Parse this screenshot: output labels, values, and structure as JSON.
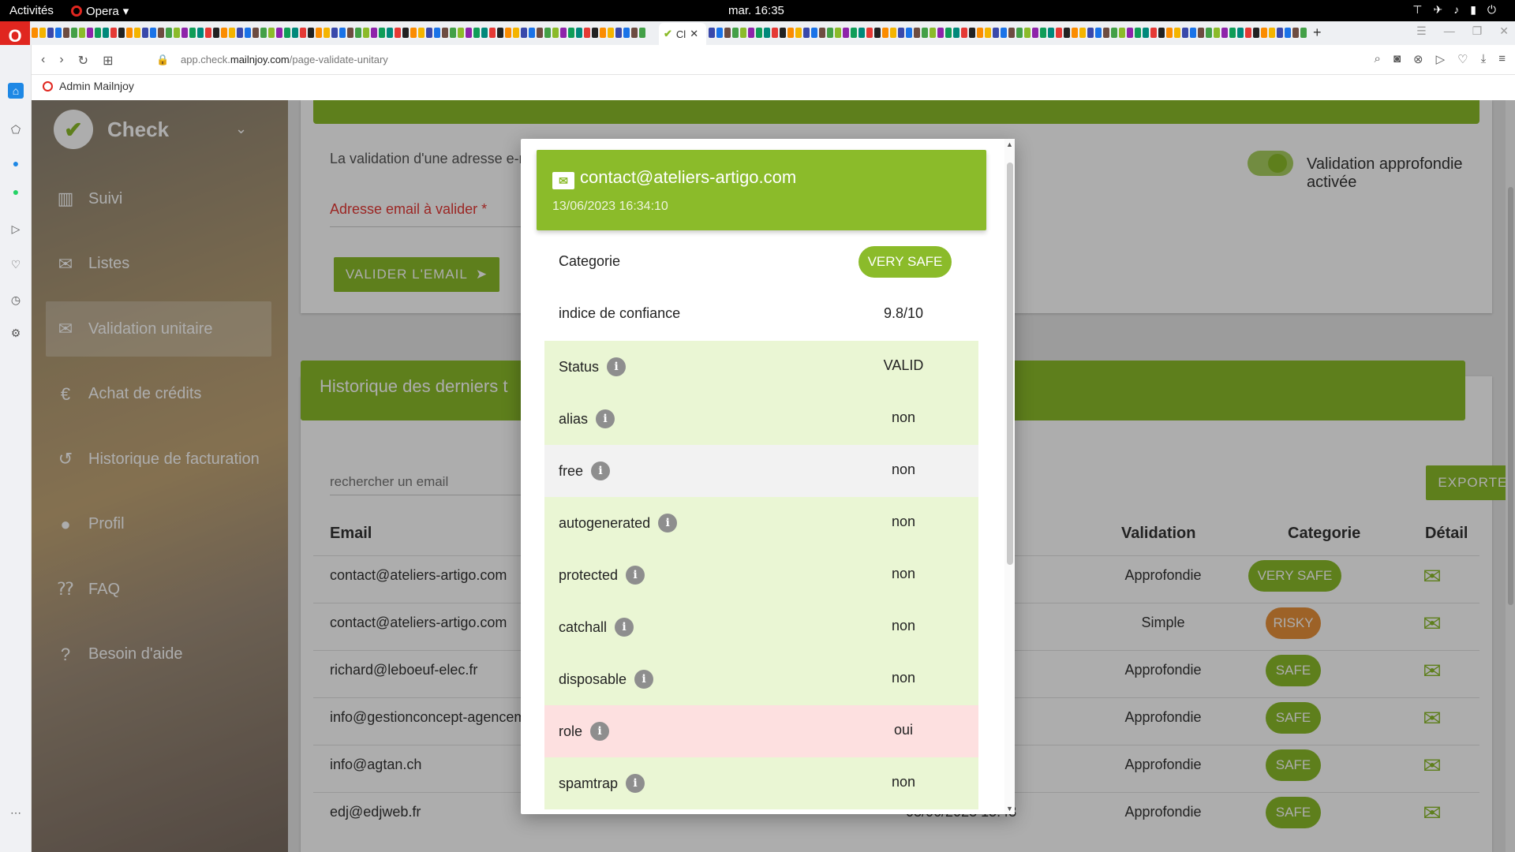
{
  "system_bar": {
    "activities": "Activités",
    "app_name": "Opera",
    "clock": "mar. 16:35"
  },
  "browser": {
    "active_tab_label": "Cl",
    "url_prefix": "app.check.",
    "url_domain": "mailnjoy.com",
    "url_path": "/page-validate-unitary",
    "bookmark": "Admin Mailnjoy"
  },
  "sidebar": {
    "brand": "Check",
    "items": [
      {
        "label": "Suivi",
        "icon": "bar-chart-icon"
      },
      {
        "label": "Listes",
        "icon": "mail-icon"
      },
      {
        "label": "Validation unitaire",
        "icon": "mail-icon"
      },
      {
        "label": "Achat de crédits",
        "icon": "euro-icon"
      },
      {
        "label": "Historique de facturation",
        "icon": "history-icon"
      },
      {
        "label": "Profil",
        "icon": "person-icon"
      },
      {
        "label": "FAQ",
        "icon": "faq-icon"
      },
      {
        "label": "Besoin d'aide",
        "icon": "help-icon"
      }
    ],
    "active_index": 2
  },
  "validate": {
    "intro": "La validation d'une adresse e-mai",
    "email_label": "Adresse email à valider *",
    "button": "VALIDER L'EMAIL",
    "toggle_label": "Validation approfondie activée"
  },
  "history": {
    "title": "Historique des derniers t",
    "search_placeholder": "rechercher un email",
    "export_button": "EXPORTER",
    "headers": {
      "email": "Email",
      "validation": "Validation",
      "categorie": "Categorie",
      "detail": "Détail"
    },
    "rows": [
      {
        "email": "contact@ateliers-artigo.com",
        "date": "",
        "validation": "Approfondie",
        "categorie": "VERY SAFE",
        "cat_class": "very-safe"
      },
      {
        "email": "contact@ateliers-artigo.com",
        "date": "",
        "validation": "Simple",
        "categorie": "RISKY",
        "cat_class": "risky"
      },
      {
        "email": "richard@leboeuf-elec.fr",
        "date": "",
        "validation": "Approfondie",
        "categorie": "SAFE",
        "cat_class": "safe"
      },
      {
        "email": "info@gestionconcept-agencem",
        "date": "",
        "validation": "Approfondie",
        "categorie": "SAFE",
        "cat_class": "safe"
      },
      {
        "email": "info@agtan.ch",
        "date": "",
        "validation": "Approfondie",
        "categorie": "SAFE",
        "cat_class": "safe"
      },
      {
        "email": "edj@edjweb.fr",
        "date": "03/06/2023 15:43",
        "validation": "Approfondie",
        "categorie": "SAFE",
        "cat_class": "safe"
      }
    ]
  },
  "modal": {
    "email": "contact@ateliers-artigo.com",
    "date": "13/06/2023 16:34:10",
    "categorie_label": "Categorie",
    "categorie_value": "VERY SAFE",
    "confidence_label": "indice de confiance",
    "confidence_value": "9.8/10",
    "checks": [
      {
        "label": "Status",
        "value": "VALID",
        "tone": "green"
      },
      {
        "label": "alias",
        "value": "non",
        "tone": "green"
      },
      {
        "label": "free",
        "value": "non",
        "tone": "grey"
      },
      {
        "label": "autogenerated",
        "value": "non",
        "tone": "green"
      },
      {
        "label": "protected",
        "value": "non",
        "tone": "green"
      },
      {
        "label": "catchall",
        "value": "non",
        "tone": "green"
      },
      {
        "label": "disposable",
        "value": "non",
        "tone": "green"
      },
      {
        "label": "role",
        "value": "oui",
        "tone": "red"
      },
      {
        "label": "spamtrap",
        "value": "non",
        "tone": "green"
      }
    ]
  },
  "colors": {
    "brand_green": "#8bbb2a",
    "risky_orange": "#e8913a",
    "row_green": "#eaf6d4",
    "row_red": "#fde0e0"
  }
}
